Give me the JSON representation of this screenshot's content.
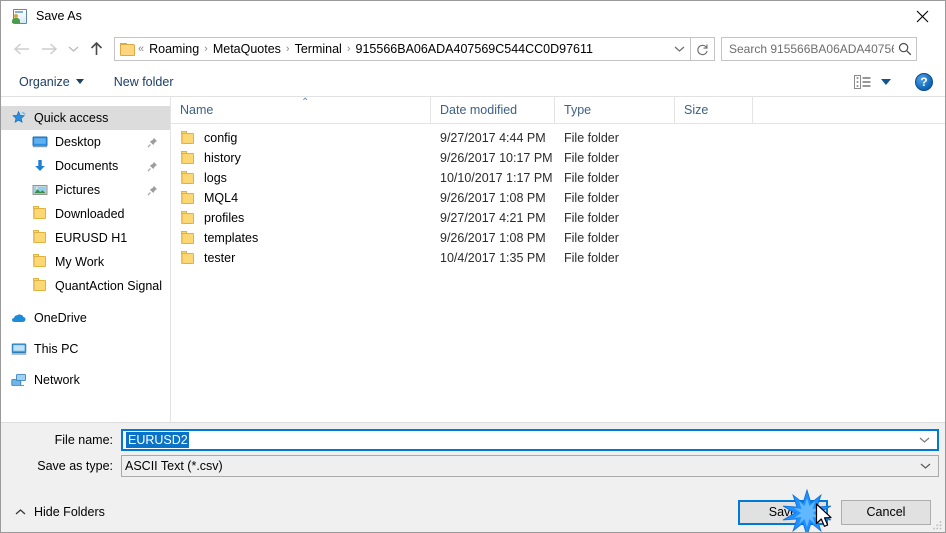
{
  "window": {
    "title": "Save As",
    "title_icon": "save-as-icon",
    "close_icon": "close-icon"
  },
  "nav": {
    "back_icon": "arrow-left-icon",
    "forward_icon": "arrow-right-icon",
    "recent_icon": "chevron-down-icon",
    "up_icon": "arrow-up-icon",
    "refresh_icon": "refresh-icon",
    "dropdown_icon": "chevron-down-icon",
    "folder_icon": "folder-icon",
    "breadcrumb_prefix": "«",
    "breadcrumb": [
      "Roaming",
      "MetaQuotes",
      "Terminal",
      "915566BA06ADA407569C544CC0D97611"
    ],
    "separator": "›"
  },
  "search": {
    "placeholder": "Search 915566BA06ADA40756...",
    "icon": "search-icon"
  },
  "toolbar": {
    "organize_label": "Organize",
    "new_folder_label": "New folder",
    "view_icon": "view-options-icon",
    "help_label": "?",
    "help_icon": "help-icon"
  },
  "sidebar": {
    "items": [
      {
        "label": "Quick access",
        "icon": "star-pin-icon",
        "level": 0,
        "selected": true,
        "pinned": false
      },
      {
        "label": "Desktop",
        "icon": "desktop-icon",
        "level": 1,
        "selected": false,
        "pinned": true
      },
      {
        "label": "Documents",
        "icon": "documents-download-icon",
        "level": 1,
        "selected": false,
        "pinned": true
      },
      {
        "label": "Pictures",
        "icon": "pictures-icon",
        "level": 1,
        "selected": false,
        "pinned": true
      },
      {
        "label": "Downloaded",
        "icon": "folder-icon",
        "level": 1,
        "selected": false,
        "pinned": false
      },
      {
        "label": "EURUSD H1",
        "icon": "folder-icon",
        "level": 1,
        "selected": false,
        "pinned": false
      },
      {
        "label": "My Work",
        "icon": "folder-icon",
        "level": 1,
        "selected": false,
        "pinned": false
      },
      {
        "label": "QuantAction Signal",
        "icon": "folder-icon",
        "level": 1,
        "selected": false,
        "pinned": false
      },
      {
        "label": "OneDrive",
        "icon": "onedrive-cloud-icon",
        "level": 0,
        "selected": false,
        "pinned": false
      },
      {
        "label": "This PC",
        "icon": "this-pc-icon",
        "level": 0,
        "selected": false,
        "pinned": false
      },
      {
        "label": "Network",
        "icon": "network-icon",
        "level": 0,
        "selected": false,
        "pinned": false
      }
    ]
  },
  "filelist": {
    "columns": [
      "Name",
      "Date modified",
      "Type",
      "Size"
    ],
    "sort_column": "Name",
    "sort_caret": "⌃",
    "rows": [
      {
        "name": "config",
        "date": "9/27/2017 4:44 PM",
        "type": "File folder",
        "size": "",
        "icon": "folder-icon"
      },
      {
        "name": "history",
        "date": "9/26/2017 10:17 PM",
        "type": "File folder",
        "size": "",
        "icon": "folder-icon"
      },
      {
        "name": "logs",
        "date": "10/10/2017 1:17 PM",
        "type": "File folder",
        "size": "",
        "icon": "folder-icon"
      },
      {
        "name": "MQL4",
        "date": "9/26/2017 1:08 PM",
        "type": "File folder",
        "size": "",
        "icon": "folder-icon"
      },
      {
        "name": "profiles",
        "date": "9/27/2017 4:21 PM",
        "type": "File folder",
        "size": "",
        "icon": "folder-icon"
      },
      {
        "name": "templates",
        "date": "9/26/2017 1:08 PM",
        "type": "File folder",
        "size": "",
        "icon": "folder-icon"
      },
      {
        "name": "tester",
        "date": "10/4/2017 1:35 PM",
        "type": "File folder",
        "size": "",
        "icon": "folder-icon"
      }
    ]
  },
  "form": {
    "filename_label": "File name:",
    "filename_value": "EURUSD2",
    "savetype_label": "Save as type:",
    "savetype_value": "ASCII Text (*.csv)",
    "dropdown_icon": "chevron-down-icon"
  },
  "footer": {
    "hide_folders_label": "Hide Folders",
    "hide_folders_icon": "chevron-up-icon",
    "save_label": "Save",
    "cancel_label": "Cancel",
    "resize_grip_icon": "resize-grip-icon",
    "click_effect_icon": "click-burst-icon",
    "cursor_icon": "mouse-cursor-icon"
  },
  "colors": {
    "accent": "#0078d7",
    "selection": "#0a73c8",
    "sidebar_selected": "#dcdcdc",
    "folder_yellow": "#fcd874",
    "header_text": "#3d6185",
    "toolbar_text": "#1c3f66",
    "burst_blue": "#1e90ff"
  }
}
